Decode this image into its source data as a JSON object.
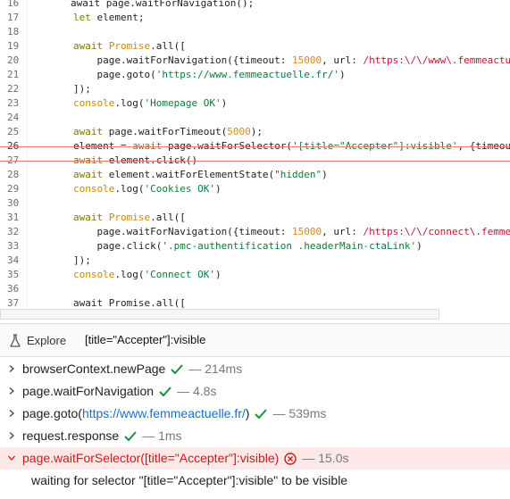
{
  "editor": {
    "lines": [
      {
        "n": "16",
        "segs": [
          {
            "t": "        await page.waitForNavigation();",
            "c": ""
          }
        ]
      },
      {
        "n": "17",
        "segs": [
          {
            "t": "let ",
            "c": "kw"
          },
          {
            "t": "element;",
            "c": ""
          }
        ]
      },
      {
        "n": "18",
        "segs": []
      },
      {
        "n": "19",
        "segs": [
          {
            "t": "await ",
            "c": "kw"
          },
          {
            "t": "Promise",
            "c": "cls"
          },
          {
            "t": ".all([",
            "c": ""
          }
        ]
      },
      {
        "n": "20",
        "segs": [
          {
            "t": "    page.waitForNavigation({timeout: ",
            "c": ""
          },
          {
            "t": "15000",
            "c": "num"
          },
          {
            "t": ", url: ",
            "c": ""
          },
          {
            "t": "/https:\\/\\/www\\.femmeactu",
            "c": "re"
          }
        ]
      },
      {
        "n": "21",
        "segs": [
          {
            "t": "    page.goto(",
            "c": ""
          },
          {
            "t": "'https://www.femmeactuelle.fr/'",
            "c": "str2"
          },
          {
            "t": ")",
            "c": ""
          }
        ]
      },
      {
        "n": "22",
        "segs": [
          {
            "t": "]);",
            "c": ""
          }
        ]
      },
      {
        "n": "23",
        "segs": [
          {
            "t": "console",
            "c": "log"
          },
          {
            "t": ".log(",
            "c": ""
          },
          {
            "t": "'Homepage OK'",
            "c": "str2"
          },
          {
            "t": ")",
            "c": ""
          }
        ]
      },
      {
        "n": "24",
        "segs": []
      },
      {
        "n": "25",
        "segs": [
          {
            "t": "await ",
            "c": "kw"
          },
          {
            "t": "page.waitForTimeout(",
            "c": ""
          },
          {
            "t": "5000",
            "c": "num"
          },
          {
            "t": ");",
            "c": ""
          }
        ]
      },
      {
        "n": "26",
        "segs": [
          {
            "t": "element = ",
            "c": ""
          },
          {
            "t": "await ",
            "c": "kw"
          },
          {
            "t": "page.waitForSelector(",
            "c": ""
          },
          {
            "t": "'[title=\"Accepter\"]:visible'",
            "c": "str2"
          },
          {
            "t": ", {timeou",
            "c": ""
          }
        ]
      },
      {
        "n": "27",
        "segs": [
          {
            "t": "await ",
            "c": "kw"
          },
          {
            "t": "element.click()",
            "c": ""
          }
        ]
      },
      {
        "n": "28",
        "segs": [
          {
            "t": "await ",
            "c": "kw"
          },
          {
            "t": "element.waitForElementState(",
            "c": ""
          },
          {
            "t": "\"hidden\"",
            "c": "str2"
          },
          {
            "t": ")",
            "c": ""
          }
        ]
      },
      {
        "n": "29",
        "segs": [
          {
            "t": "console",
            "c": "log"
          },
          {
            "t": ".log(",
            "c": ""
          },
          {
            "t": "'Cookies OK'",
            "c": "str2"
          },
          {
            "t": ")",
            "c": ""
          }
        ]
      },
      {
        "n": "30",
        "segs": []
      },
      {
        "n": "31",
        "segs": [
          {
            "t": "await ",
            "c": "kw"
          },
          {
            "t": "Promise",
            "c": "cls"
          },
          {
            "t": ".all([",
            "c": ""
          }
        ]
      },
      {
        "n": "32",
        "segs": [
          {
            "t": "    page.waitForNavigation({timeout: ",
            "c": ""
          },
          {
            "t": "15000",
            "c": "num"
          },
          {
            "t": ", url: ",
            "c": ""
          },
          {
            "t": "/https:\\/\\/connect\\.femme",
            "c": "re"
          }
        ]
      },
      {
        "n": "33",
        "segs": [
          {
            "t": "    page.click(",
            "c": ""
          },
          {
            "t": "'.pmc-authentification .headerMain-ctaLink'",
            "c": "str2"
          },
          {
            "t": ")",
            "c": ""
          }
        ]
      },
      {
        "n": "34",
        "segs": [
          {
            "t": "]);",
            "c": ""
          }
        ]
      },
      {
        "n": "35",
        "segs": [
          {
            "t": "console",
            "c": "log"
          },
          {
            "t": ".log(",
            "c": ""
          },
          {
            "t": "'Connect OK'",
            "c": "str2"
          },
          {
            "t": ")",
            "c": ""
          }
        ]
      },
      {
        "n": "36",
        "segs": []
      },
      {
        "n": "37",
        "segs": [
          {
            "t": "await Promise.all([",
            "c": ""
          }
        ]
      }
    ]
  },
  "explore": {
    "label": "Explore",
    "selector": "[title=\"Accepter\"]:visible"
  },
  "log": {
    "entries": [
      {
        "title": "browserContext.newPage",
        "duration": "— 214ms",
        "status": "ok"
      },
      {
        "title": "page.waitForNavigation",
        "duration": "— 4.8s",
        "status": "ok"
      },
      {
        "title_prefix": "page.goto(",
        "link": "https://www.femmeactuelle.fr/",
        "title_suffix": ")",
        "duration": "— 539ms",
        "status": "ok"
      },
      {
        "title": "request.response",
        "duration": "— 1ms",
        "status": "ok"
      },
      {
        "title": "page.waitForSelector([title=\"Accepter\"]:visible)",
        "duration": "— 15.0s",
        "status": "error"
      }
    ],
    "error_detail": "waiting for selector \"[title=\"Accepter\"]:visible\" to be visible"
  },
  "colors": {
    "ok": "#1e8e3e",
    "error": "#d01818",
    "link": "#1a6fc4"
  }
}
